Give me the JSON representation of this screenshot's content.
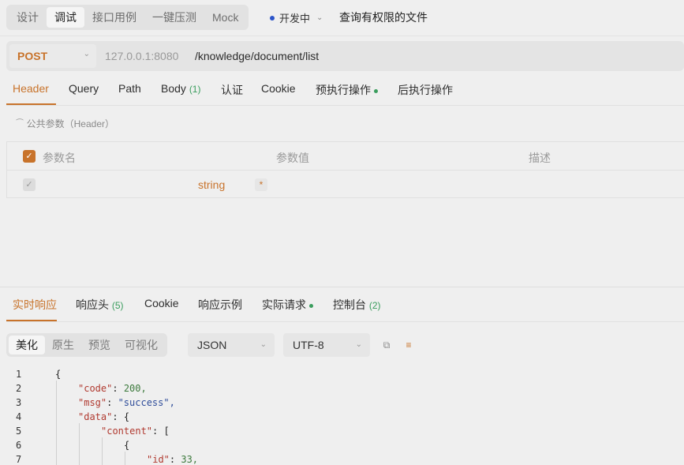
{
  "modes": [
    "设计",
    "调试",
    "接口用例",
    "一键压测",
    "Mock"
  ],
  "active_mode": "调试",
  "environment": {
    "label": "开发中",
    "dot_color": "#2b54c9"
  },
  "api_name": "查询有权限的文件",
  "request": {
    "method": "POST",
    "host": "127.0.0.1:8080",
    "path": "/knowledge/document/list",
    "method_color": "#c8732b"
  },
  "request_tabs": {
    "header": "Header",
    "query": "Query",
    "path": "Path",
    "body": "Body",
    "body_count": "(1)",
    "auth": "认证",
    "cookie": "Cookie",
    "pre": "预执行操作",
    "post": "后执行操作"
  },
  "public_params_label": "公共参数（Header）",
  "param_table": {
    "headers": {
      "name": "参数名",
      "value": "参数值",
      "desc": "描述"
    },
    "rows": [
      {
        "type": "string",
        "required_mark": "*"
      }
    ]
  },
  "response_tabs": {
    "live": "实时响应",
    "headers": "响应头",
    "headers_count": "(5)",
    "cookie": "Cookie",
    "example": "响应示例",
    "actual": "实际请求",
    "console": "控制台",
    "console_count": "(2)"
  },
  "format_modes": [
    "美化",
    "原生",
    "预览",
    "可视化"
  ],
  "active_format": "美化",
  "format_select": "JSON",
  "encoding_select": "UTF-8",
  "code_lines": [
    {
      "no": "1",
      "key": "",
      "text": "{"
    },
    {
      "no": "2",
      "key": "\"code\"",
      "text": "200,"
    },
    {
      "no": "3",
      "key": "\"msg\"",
      "text": "\"success\","
    },
    {
      "no": "4",
      "key": "\"data\"",
      "text": "{"
    },
    {
      "no": "5",
      "key": "\"content\"",
      "text": "["
    },
    {
      "no": "6",
      "key": "",
      "text": "{"
    },
    {
      "no": "7",
      "key": "\"id\"",
      "text": "33,"
    }
  ],
  "accent_color": "#c8732b",
  "count_color": "#3a9d5d"
}
